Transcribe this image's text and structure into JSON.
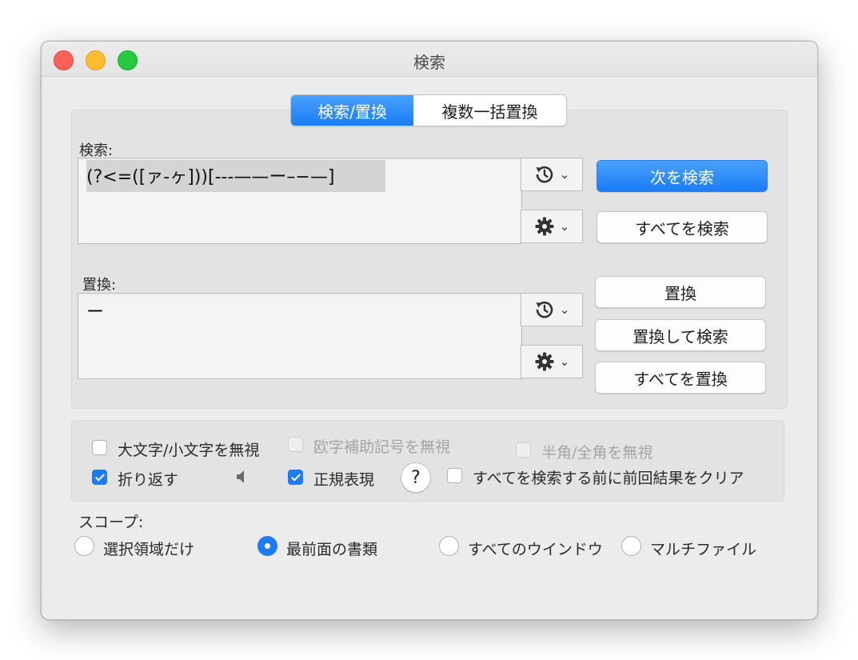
{
  "window": {
    "title": "検索"
  },
  "tabs": [
    {
      "label": "検索/置換",
      "active": true
    },
    {
      "label": "複数一括置換",
      "active": false
    }
  ],
  "find": {
    "label": "検索:",
    "value": "(?<=([ァ-ヶ]))[---——ー–−—]"
  },
  "replace": {
    "label": "置換:",
    "value": "ー"
  },
  "buttons": {
    "find_next": "次を検索",
    "find_all": "すべてを検索",
    "replace": "置換",
    "replace_and_find": "置換して検索",
    "replace_all": "すべてを置換"
  },
  "options": {
    "ignore_case": {
      "label": "大文字/小文字を無視",
      "checked": false,
      "enabled": true
    },
    "ignore_diacritics": {
      "label": "欧字補助記号を無視",
      "checked": false,
      "enabled": false
    },
    "ignore_width": {
      "label": "半角/全角を無視",
      "checked": false,
      "enabled": false
    },
    "wrap": {
      "label": "折り返す",
      "checked": true,
      "enabled": true
    },
    "regex": {
      "label": "正規表現",
      "checked": true,
      "enabled": true
    },
    "help": "?",
    "clear_before": {
      "label": "すべてを検索する前に前回結果をクリア",
      "checked": false,
      "enabled": true
    }
  },
  "scope": {
    "label": "スコープ:",
    "options": [
      {
        "label": "選択領域だけ",
        "selected": false
      },
      {
        "label": "最前面の書類",
        "selected": true
      },
      {
        "label": "すべてのウインドウ",
        "selected": false
      },
      {
        "label": "マルチファイル",
        "selected": false
      }
    ]
  },
  "colors": {
    "accent": "#1e7cf2"
  }
}
